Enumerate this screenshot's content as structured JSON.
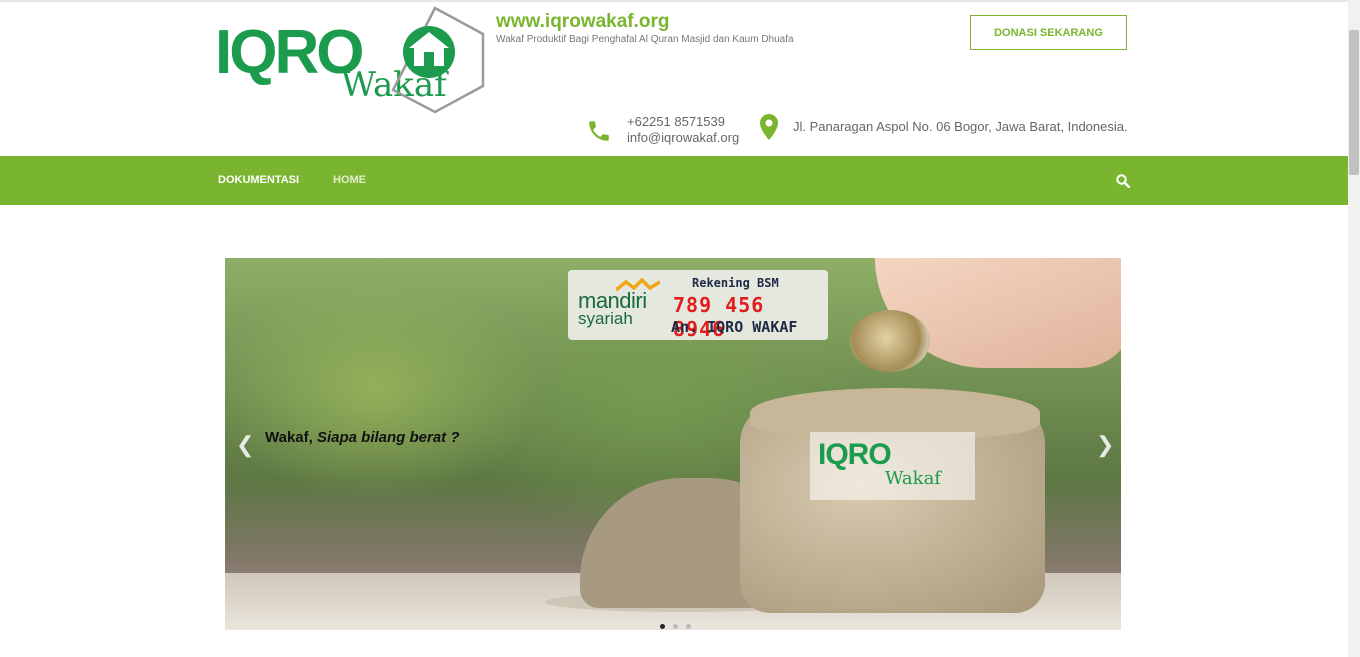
{
  "header": {
    "logo_text": "IQRO",
    "logo_sub": "Wakaf",
    "site_url": "www.iqrowakaf.org",
    "tagline": "Wakaf Produktif Bagi Penghafal Al Quran Masjid dan Kaum Dhuafa",
    "donate_label": "DONASI SEKARANG",
    "phone": "+62251 8571539",
    "email": "info@iqrowakaf.org",
    "address": "Jl. Panaragan Aspol No. 06 Bogor, Jawa Barat, Indonesia.",
    "icons": [
      "phone-icon",
      "map-pin-icon"
    ]
  },
  "nav": {
    "items": [
      {
        "label": "DOKUMENTASI"
      },
      {
        "label": "HOME"
      }
    ],
    "search_icon": "search-icon"
  },
  "slider": {
    "bank_name": "mandiri",
    "bank_sub": "syariah",
    "bank_title": "Rekening BSM",
    "account_number": "789 456 8946",
    "account_owner": "An. IQRO WAKAF",
    "bag_logo": "IQRO",
    "bag_logo_sub": "Wakaf",
    "caption_plain": "Wakaf,",
    "caption_italic": "Siapa bilang berat ?",
    "prev_icon": "chevron-left-icon",
    "next_icon": "chevron-right-icon",
    "dots_total": 3,
    "dots_active": 1
  },
  "colors": {
    "brand_green": "#7ab52f",
    "logo_green": "#1c9b4e",
    "account_red": "#e21d1d"
  }
}
